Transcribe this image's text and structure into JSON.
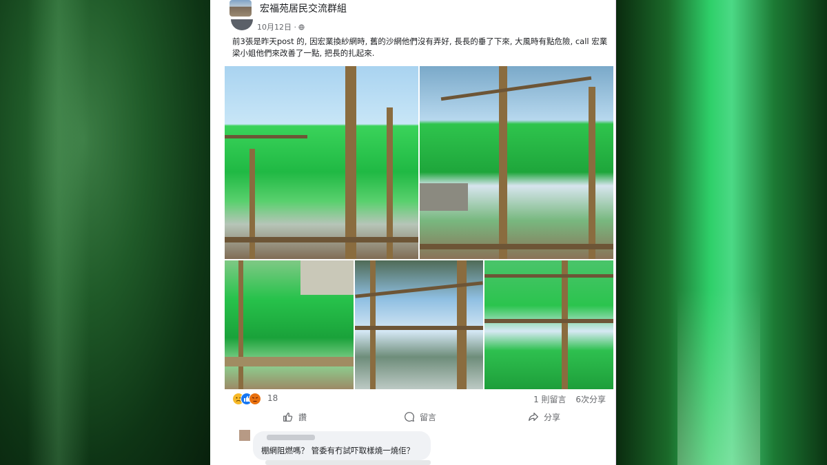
{
  "background": {
    "accent_left": "#1f5a28",
    "accent_right": "#2fd06a"
  },
  "group": {
    "name": "宏福苑居民交流群組",
    "date": "10月12日 · ",
    "privacy_icon": "globe-icon"
  },
  "post": {
    "text": "前3張是昨天post 的, 因宏業換紗網時, 舊的沙網他們沒有弄好, 長長的垂了下來, 大風時有點危險, call 宏業梁小姐他們來改善了一點, 把長的扎起來.",
    "photos": [
      "photo-1",
      "photo-2",
      "photo-3",
      "photo-4",
      "photo-5"
    ]
  },
  "reactions": {
    "icons": [
      "sad-icon",
      "like-icon",
      "angry-icon"
    ],
    "count": "18",
    "comments": "1 則留言",
    "shares": "6次分享"
  },
  "actions": {
    "like": "讚",
    "comment": "留言",
    "share": "分享"
  },
  "comment": {
    "text": "棚網阻燃嗎？ 管委有冇試吓取樣燒一燒佢？"
  },
  "colors": {
    "text_primary": "#1c1e21",
    "text_secondary": "#65676b",
    "bubble": "#f0f2f5"
  }
}
